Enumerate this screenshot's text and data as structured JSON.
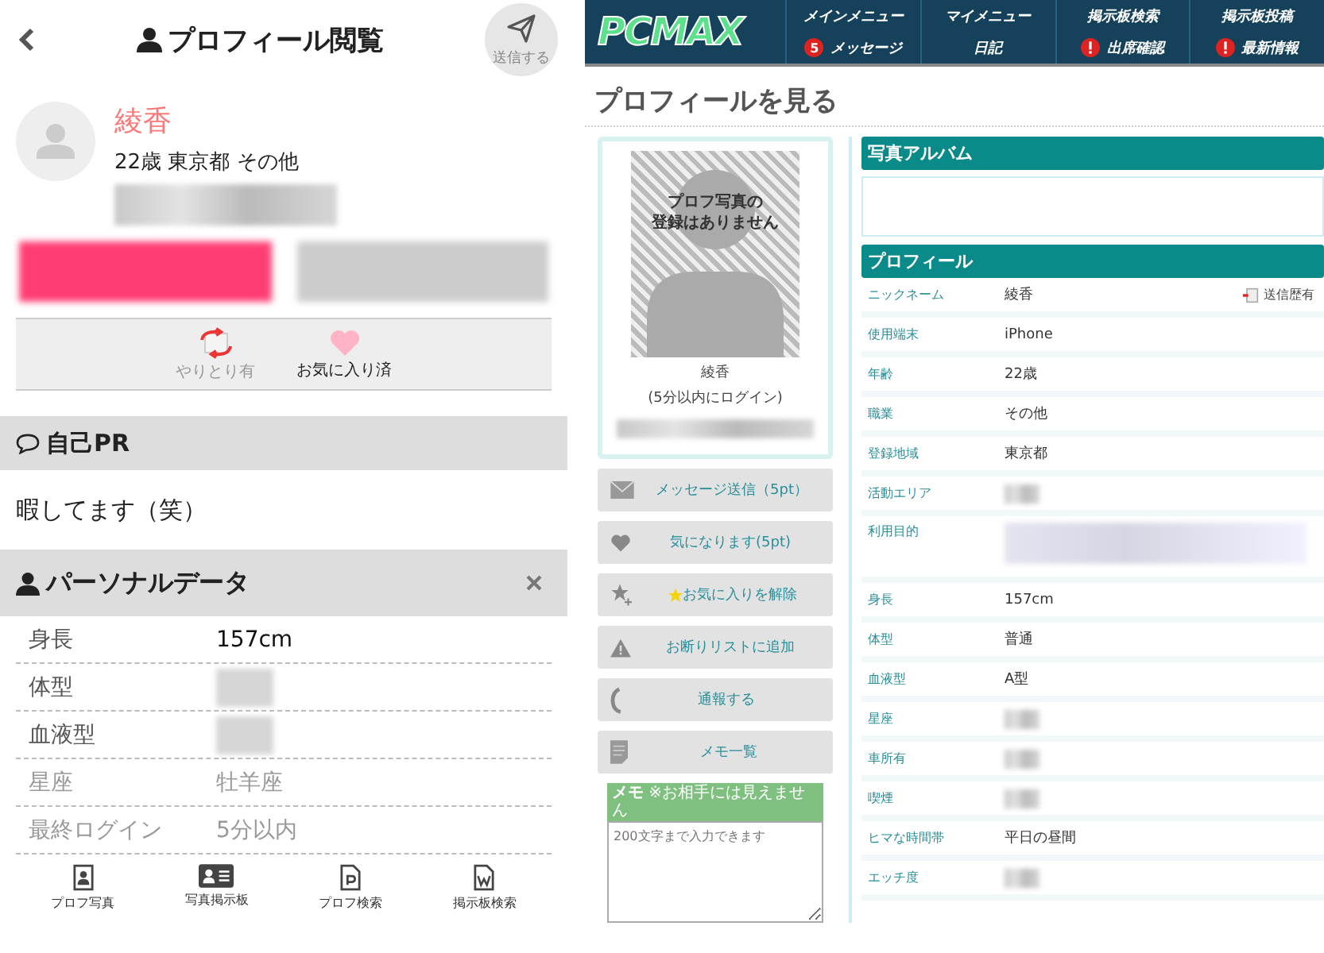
{
  "mobile": {
    "title": "プロフィール閲覧",
    "send_label": "送信する",
    "profile": {
      "name": "綾香",
      "details": "22歳 東京都 その他"
    },
    "blurred_buttons": [
      {
        "color": "#ff3d73"
      },
      {
        "color": "#cccccc"
      }
    ],
    "status": [
      {
        "kind": "exchange",
        "label": "やりとり有",
        "active": false
      },
      {
        "kind": "favorite",
        "label": "お気に入り済",
        "active": true
      }
    ],
    "self_pr": {
      "heading": "自己PR",
      "text": "暇してます（笑）"
    },
    "personal": {
      "heading": "パーソナルデータ",
      "rows": [
        {
          "label": "身長",
          "value": "157cm",
          "blurred": false,
          "faded": false
        },
        {
          "label": "体型",
          "blurred": true,
          "faded": false
        },
        {
          "label": "血液型",
          "blurred": true,
          "faded": false
        },
        {
          "label": "星座",
          "value": "牡羊座",
          "blurred": false,
          "faded": true
        },
        {
          "label": "最終ログイン",
          "value": "5分以内",
          "blurred": false,
          "faded": true
        }
      ]
    },
    "tabbar": [
      {
        "kind": "photo",
        "label": "プロフ写真"
      },
      {
        "kind": "board",
        "label": "写真掲示板"
      },
      {
        "kind": "p",
        "label": "プロフ検索"
      },
      {
        "kind": "w",
        "label": "掲示板検索"
      }
    ]
  },
  "desktop": {
    "logo": "PCMAX",
    "nav": [
      {
        "label": "メインメニュー",
        "kind": "plain"
      },
      {
        "label": "マイメニュー",
        "kind": "plain"
      },
      {
        "label": "掲示板検索",
        "kind": "plain"
      },
      {
        "label": "掲示板投稿",
        "kind": "plain"
      },
      {
        "label": "メッセージ",
        "kind": "badge",
        "badge": "5"
      },
      {
        "label": "日記",
        "kind": "plain"
      },
      {
        "label": "出席確認",
        "kind": "alert"
      },
      {
        "label": "最新情報",
        "kind": "alert"
      }
    ],
    "page_title": "プロフィールを見る",
    "card": {
      "photo_text": [
        "プロフ写真の",
        "登録はありません"
      ],
      "name": "綾香",
      "login": "(5分以内にログイン)"
    },
    "actions": [
      {
        "kind": "mail",
        "label": "メッセージ送信（5pt）"
      },
      {
        "kind": "heart",
        "label": "気になります(5pt)"
      },
      {
        "kind": "star",
        "label": "お気に入りを解除"
      },
      {
        "kind": "warn",
        "label": "お断りリストに追加"
      },
      {
        "kind": "phone",
        "label": "通報する"
      },
      {
        "kind": "memo",
        "label": "メモ一覧"
      }
    ],
    "memo": {
      "heading": "メモ",
      "note": "※お相手には見えません",
      "placeholder": "200文字まで入力できます"
    },
    "album_heading": "写真アルバム",
    "profile_heading": "プロフィール",
    "rows": [
      {
        "label": "ニックネーム",
        "value": "綾香",
        "blurred": false,
        "extra": "送信歴有"
      },
      {
        "label": "使用端末",
        "value": "iPhone",
        "blurred": false
      },
      {
        "label": "年齢",
        "value": "22歳",
        "blurred": false
      },
      {
        "label": "職業",
        "value": "その他",
        "blurred": false
      },
      {
        "label": "登録地域",
        "value": "東京都",
        "blurred": false
      },
      {
        "label": "活動エリア",
        "blurred": true
      },
      {
        "label": "利用目的",
        "blurred": true,
        "tall": true
      },
      {
        "label": "身長",
        "value": "157cm",
        "blurred": false
      },
      {
        "label": "体型",
        "value": "普通",
        "blurred": false
      },
      {
        "label": "血液型",
        "value": "A型",
        "blurred": false
      },
      {
        "label": "星座",
        "blurred": true
      },
      {
        "label": "車所有",
        "blurred": true
      },
      {
        "label": "喫煙",
        "blurred": true
      },
      {
        "label": "ヒマな時間帯",
        "value": "平日の昼間",
        "blurred": false
      },
      {
        "label": "エッチ度",
        "blurred": true
      }
    ]
  }
}
